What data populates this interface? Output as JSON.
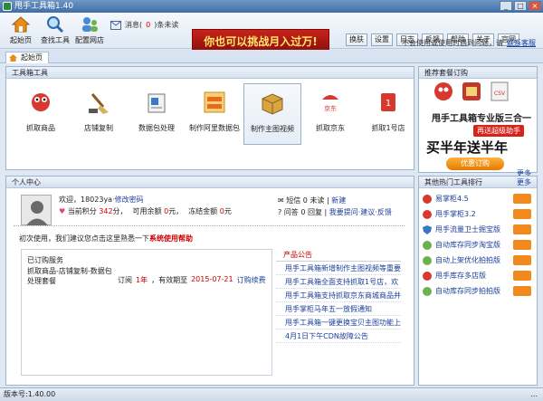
{
  "window": {
    "title": "甩手工具箱1.40",
    "buttons": [
      "_",
      "□",
      "×"
    ]
  },
  "toolbar": {
    "items": [
      {
        "label": "起始页"
      },
      {
        "label": "查找工具"
      },
      {
        "label": "配置网店"
      }
    ],
    "message_label": "消息(",
    "message_count": "0",
    "message_suffix": ")条未读",
    "banner_text": "你也可以挑战月入过万!",
    "top_buttons": [
      "换肤",
      "设置",
      "日志",
      "反馈",
      "帮助",
      "关于",
      "官网"
    ],
    "lock_text": "不会使用或使用时遇到问题，请",
    "lock_link": "联系客服"
  },
  "tabs": [
    {
      "label": "起始页"
    }
  ],
  "tools_panel": {
    "title": "工具箱工具",
    "tools": [
      {
        "label": "抓取商品"
      },
      {
        "label": "店铺复制"
      },
      {
        "label": "数据包处理"
      },
      {
        "label": "制作阿里数据包"
      },
      {
        "label": "制作主图视频"
      },
      {
        "label": "抓取京东"
      },
      {
        "label": "抓取1号店"
      }
    ]
  },
  "subscribe_panel": {
    "title": "推荐套餐订购",
    "brand": "甩手工具箱专业版三合一",
    "tag": "再送超级助手",
    "headline": "买半年送半年",
    "button": "优惠订购",
    "more": "更多"
  },
  "personal_panel": {
    "title": "个人中心",
    "welcome": "欢迎，",
    "username": "18023ya",
    "edit_password": "·修改密码",
    "points_label": "当前积分",
    "points": "342",
    "points_unit": "分，",
    "balance_label": "可用余额",
    "balance": "0",
    "balance_unit": "元，",
    "frozen_label": "冻结金额",
    "frozen": "0",
    "frozen_unit": "元",
    "sms_label": "短信",
    "sms_value": "0 未读",
    "sms_new": "新建",
    "qa_label": "问答",
    "qa_value": "0 回复",
    "qa_link": "我要提问·建议·反馈",
    "tip_prefix": "初次使用，我们建议您点击这里熟悉一下",
    "tip_link": "系统使用帮助",
    "ordered_title": "已订购服务",
    "ordered_name": "抓取商品-店铺复制-数据包处理套餐",
    "ordered_status": "订阅",
    "ordered_period": "1年",
    "ordered_expire_label": "，有效期至",
    "ordered_expire": "2015-07-21",
    "ordered_renew": "订购续费"
  },
  "news": {
    "title": "产品公告",
    "items": [
      "甩手工具箱新增制作主图视频等重要",
      "甩手工具箱全面支持抓取1号店，欢",
      "甩手工具箱支持抓取京东商城商品并",
      "甩手掌柜马年五一放假通知",
      "甩手工具箱一键更换宝贝主图功能上",
      "4月1日下午CDN故障公告"
    ]
  },
  "hot_tools": {
    "title": "其他热门工具排行",
    "more": "更多",
    "items": [
      {
        "label": "易掌柜4.5"
      },
      {
        "label": "甩手掌柜3.2"
      },
      {
        "label": "甩手流量卫士掘宝版"
      },
      {
        "label": "自动库存同步淘宝版"
      },
      {
        "label": "自动上架优化拍拍版"
      },
      {
        "label": "甩手库存多店版"
      },
      {
        "label": "自动库存同步拍拍版"
      }
    ]
  },
  "statusbar": {
    "version": "版本号:1.40.00",
    "right_text": "..."
  },
  "colors": {
    "accent": "#1a3f9a",
    "banner_red": "#c8221a",
    "title_blue": "#3f6fa7"
  }
}
